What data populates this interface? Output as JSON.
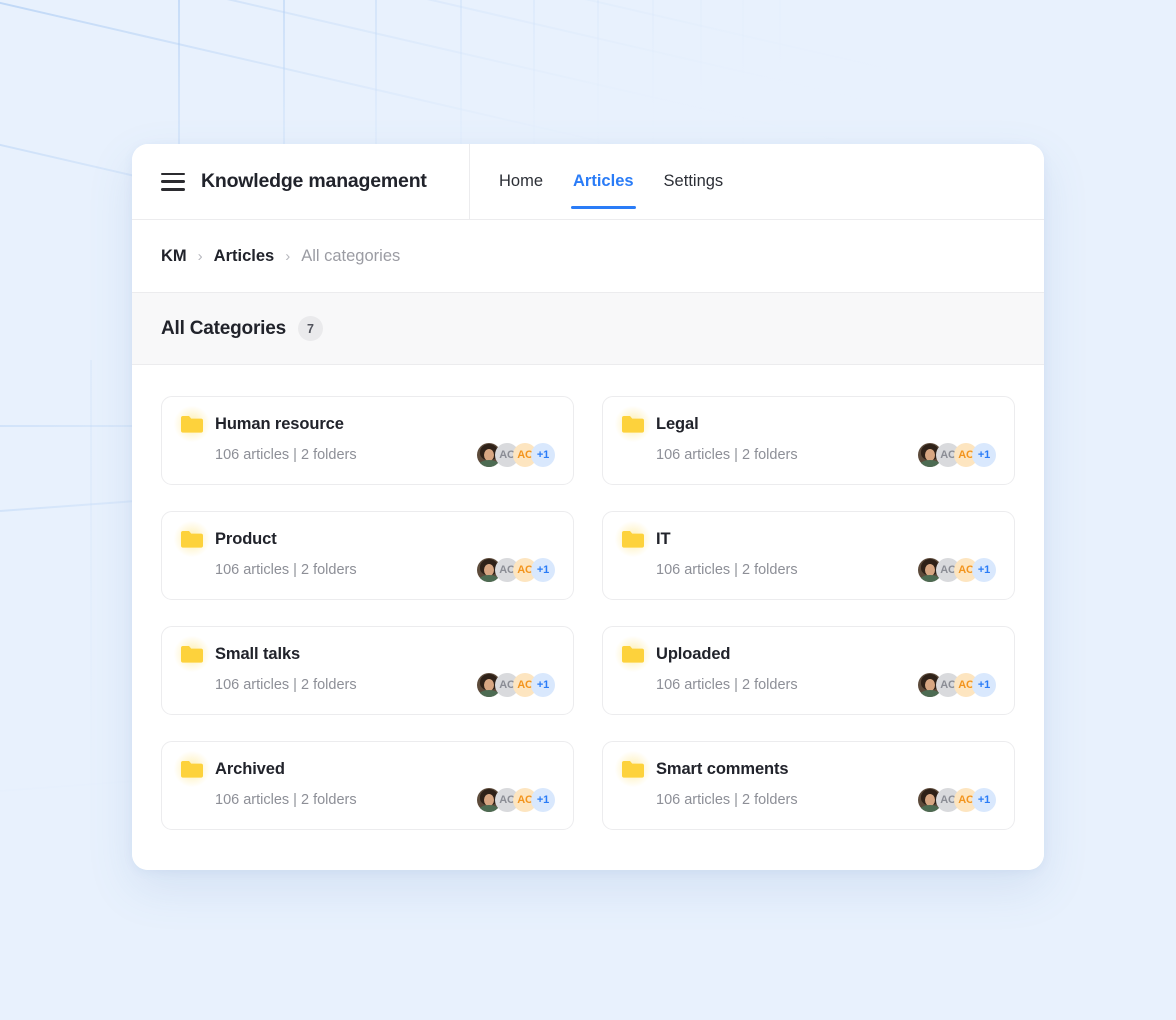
{
  "header": {
    "menu_icon": "hamburger-icon",
    "title": "Knowledge management",
    "tabs": [
      {
        "label": "Home",
        "active": false
      },
      {
        "label": "Articles",
        "active": true
      },
      {
        "label": "Settings",
        "active": false
      }
    ]
  },
  "breadcrumb": {
    "separator": "›",
    "items": [
      {
        "label": "KM",
        "muted": false
      },
      {
        "label": "Articles",
        "muted": false
      },
      {
        "label": "All categories",
        "muted": true
      }
    ]
  },
  "section": {
    "title": "All Categories",
    "count": "7"
  },
  "avatar_group": {
    "items": [
      {
        "type": "photo",
        "label": "",
        "style": "photo"
      },
      {
        "type": "initials",
        "label": "AC",
        "style": "gray"
      },
      {
        "type": "initials",
        "label": "AC",
        "style": "amber"
      },
      {
        "type": "overflow",
        "label": "+1",
        "style": "blue"
      }
    ]
  },
  "categories": [
    {
      "icon": "folder-icon",
      "title": "Human resource",
      "meta": "106 articles | 2 folders"
    },
    {
      "icon": "folder-icon",
      "title": "Legal",
      "meta": "106 articles | 2 folders"
    },
    {
      "icon": "folder-icon",
      "title": "Product",
      "meta": "106 articles | 2 folders"
    },
    {
      "icon": "folder-icon",
      "title": "IT",
      "meta": "106 articles | 2 folders"
    },
    {
      "icon": "folder-icon",
      "title": "Small talks",
      "meta": "106 articles | 2 folders"
    },
    {
      "icon": "folder-icon",
      "title": "Uploaded",
      "meta": "106 articles | 2 folders"
    },
    {
      "icon": "folder-icon",
      "title": "Archived",
      "meta": "106 articles | 2 folders"
    },
    {
      "icon": "folder-icon",
      "title": "Smart comments",
      "meta": "106 articles | 2 folders"
    }
  ],
  "colors": {
    "accent": "#2a7cf7",
    "folder": "#fdd23c",
    "page_background": "#e8f1fd",
    "section_band": "#f8f8f9",
    "avatar_amber": "#f3941d"
  }
}
